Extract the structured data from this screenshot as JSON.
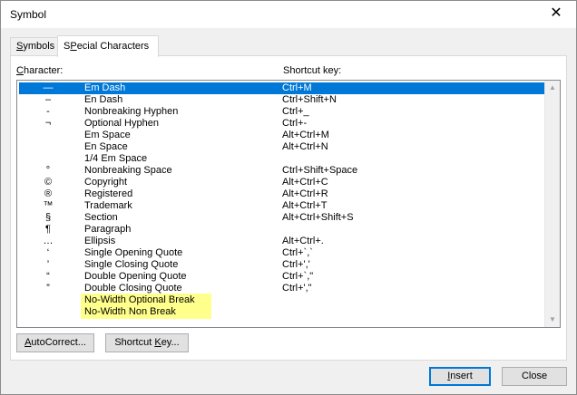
{
  "window": {
    "title": "Symbol",
    "close_glyph": "✕"
  },
  "tabs": [
    {
      "prefix": "",
      "mnemonic": "S",
      "suffix": "ymbols"
    },
    {
      "prefix": "",
      "mnemonic": "P",
      "suffix": "ecial Characters",
      "full_prefix": "S"
    }
  ],
  "columns": {
    "character": "Character:",
    "character_mnemonic": "C",
    "character_rest": "haracter:",
    "shortcut": "Shortcut key:"
  },
  "rows": [
    {
      "symbol": "—",
      "name": "Em Dash",
      "key": "Ctrl+M",
      "selected": true
    },
    {
      "symbol": "–",
      "name": "En Dash",
      "key": "Ctrl+Shift+N"
    },
    {
      "symbol": "-",
      "name": "Nonbreaking Hyphen",
      "key": "Ctrl+_"
    },
    {
      "symbol": "¬",
      "name": "Optional Hyphen",
      "key": "Ctrl+-"
    },
    {
      "symbol": "",
      "name": "Em Space",
      "key": "Alt+Ctrl+M"
    },
    {
      "symbol": "",
      "name": "En Space",
      "key": "Alt+Ctrl+N"
    },
    {
      "symbol": "",
      "name": "1/4 Em Space",
      "key": ""
    },
    {
      "symbol": "°",
      "name": "Nonbreaking Space",
      "key": "Ctrl+Shift+Space"
    },
    {
      "symbol": "©",
      "name": "Copyright",
      "key": "Alt+Ctrl+C"
    },
    {
      "symbol": "®",
      "name": "Registered",
      "key": "Alt+Ctrl+R"
    },
    {
      "symbol": "™",
      "name": "Trademark",
      "key": "Alt+Ctrl+T"
    },
    {
      "symbol": "§",
      "name": "Section",
      "key": "Alt+Ctrl+Shift+S"
    },
    {
      "symbol": "¶",
      "name": "Paragraph",
      "key": ""
    },
    {
      "symbol": "…",
      "name": "Ellipsis",
      "key": "Alt+Ctrl+."
    },
    {
      "symbol": "‘",
      "name": "Single Opening Quote",
      "key": "Ctrl+`,`"
    },
    {
      "symbol": "’",
      "name": "Single Closing Quote",
      "key": "Ctrl+','"
    },
    {
      "symbol": "“",
      "name": "Double Opening Quote",
      "key": "Ctrl+`,\""
    },
    {
      "symbol": "”",
      "name": "Double Closing Quote",
      "key": "Ctrl+',\""
    },
    {
      "symbol": "",
      "name": "No-Width Optional Break",
      "key": "",
      "highlight": true
    },
    {
      "symbol": "",
      "name": "No-Width Non Break",
      "key": "",
      "highlight": true
    }
  ],
  "buttons": {
    "autocorrect": {
      "mnemonic": "A",
      "rest": "utoCorrect..."
    },
    "shortcut_key": {
      "prefix": "Shortcut ",
      "mnemonic": "K",
      "rest": "ey..."
    },
    "insert": {
      "mnemonic": "I",
      "rest": "nsert"
    },
    "close": "Close"
  },
  "colors": {
    "selection": "#0078d7",
    "highlight": "#ffff8c",
    "default_button_border": "#0078d7"
  }
}
